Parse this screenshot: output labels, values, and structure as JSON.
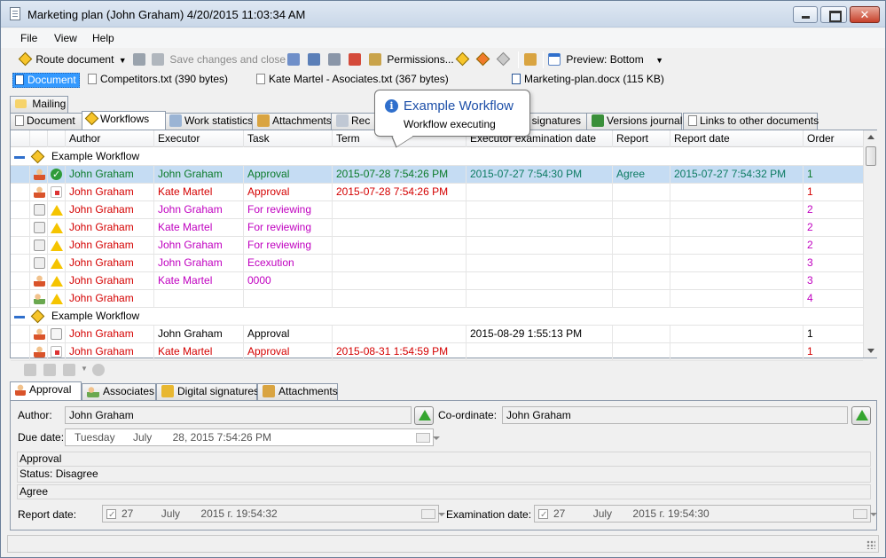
{
  "window": {
    "title": "Marketing plan (John Graham) 4/20/2015 11:03:34 AM"
  },
  "menu": [
    "File",
    "View",
    "Help"
  ],
  "toolbar": {
    "route": "Route document",
    "save_close": "Save changes and close",
    "permissions": "Permissions...",
    "preview": "Preview: Bottom"
  },
  "docs": [
    {
      "label": "Document"
    },
    {
      "label": "Competitors.txt (390 bytes)"
    },
    {
      "label": "Kate Martel - Asociates.txt (367 bytes)"
    },
    {
      "label": "Marketing-plan.docx (115 KB)"
    }
  ],
  "tabs_top": {
    "mailing": "Mailing"
  },
  "tabs": [
    "Document",
    "Workflows",
    "Work statistics",
    "Attachments",
    "Rec",
    "al signatures",
    "Versions journal",
    "Links to other documents"
  ],
  "tooltip": {
    "title": "Example Workflow",
    "subtitle": "Workflow executing",
    "icon": "i"
  },
  "grid": {
    "columns": [
      "Author",
      "Executor",
      "Task",
      "Term",
      "Executor examination date",
      "Report",
      "Report date",
      "Order"
    ],
    "groups": [
      {
        "name": "Example Workflow",
        "rows": [
          {
            "i1": "person",
            "i2": "check",
            "author": "John Graham",
            "executor": "John Graham",
            "task": "Approval",
            "term": "2015-07-28 7:54:26 PM",
            "exam": "2015-07-27 7:54:30 PM",
            "report": "Agree",
            "report_date": "2015-07-27 7:54:32 PM",
            "order": "1",
            "color": "green",
            "selected": true
          },
          {
            "i1": "person",
            "i2": "stop",
            "author": "John Graham",
            "executor": "Kate Martel",
            "task": "Approval",
            "term": "2015-07-28 7:54:26 PM",
            "exam": "",
            "report": "",
            "report_date": "",
            "order": "1",
            "color": "red"
          },
          {
            "i1": "paper",
            "i2": "warn",
            "author": "John Graham",
            "executor": "John Graham",
            "task": "For reviewing",
            "term": "",
            "exam": "",
            "report": "",
            "report_date": "",
            "order": "2",
            "color": "mag"
          },
          {
            "i1": "paper",
            "i2": "warn",
            "author": "John Graham",
            "executor": "Kate Martel",
            "task": "For reviewing",
            "term": "",
            "exam": "",
            "report": "",
            "report_date": "",
            "order": "2",
            "color": "mag"
          },
          {
            "i1": "paper",
            "i2": "warn",
            "author": "John Graham",
            "executor": "John Graham",
            "task": "For reviewing",
            "term": "",
            "exam": "",
            "report": "",
            "report_date": "",
            "order": "2",
            "color": "mag"
          },
          {
            "i1": "paper",
            "i2": "warn",
            "author": "John Graham",
            "executor": "John Graham",
            "task": "Ecexution",
            "term": "",
            "exam": "",
            "report": "",
            "report_date": "",
            "order": "3",
            "color": "mag"
          },
          {
            "i1": "person",
            "i2": "warn",
            "author": "John Graham",
            "executor": "Kate Martel",
            "task": "0000",
            "term": "",
            "exam": "",
            "report": "",
            "report_date": "",
            "order": "3",
            "color": "mag"
          },
          {
            "i1": "group",
            "i2": "warn",
            "author": "John Graham",
            "executor": "",
            "task": "",
            "term": "",
            "exam": "",
            "report": "",
            "report_date": "",
            "order": "4",
            "color": "mag"
          }
        ]
      },
      {
        "name": "Example Workflow",
        "rows": [
          {
            "i1": "person",
            "i2": "env",
            "author": "John Graham",
            "executor": "John Graham",
            "task": "Approval",
            "term": "",
            "exam": "2015-08-29 1:55:13 PM",
            "report": "",
            "report_date": "",
            "order": "1",
            "color": "black"
          },
          {
            "i1": "person",
            "i2": "stop",
            "author": "John Graham",
            "executor": "Kate Martel",
            "task": "Approval",
            "term": "2015-08-31 1:54:59 PM",
            "exam": "",
            "report": "",
            "report_date": "",
            "order": "1",
            "color": "red"
          }
        ]
      }
    ]
  },
  "detail_tabs": [
    "Approval",
    "Associates",
    "Digital signatures",
    "Attachments"
  ],
  "detail": {
    "author_label": "Author:",
    "author": "John Graham",
    "coordinate_label": "Co-ordinate:",
    "coordinate": "John Graham",
    "due_label": "Due date:",
    "due_day": "Tuesday",
    "due_month": "July",
    "due_rest": "28, 2015  7:54:26 PM",
    "type": "Approval",
    "status": "Status: Disagree",
    "comment": "Agree",
    "report_label": "Report date:",
    "report_day": "27",
    "report_month": "July",
    "report_rest": "2015 г. 19:54:32",
    "exam_label": "Examination date:",
    "exam_day": "27",
    "exam_month": "July",
    "exam_rest": "2015 г. 19:54:30"
  },
  "colors": {
    "selected_row": "#c5dcf3",
    "green": "#0a7a29",
    "red": "#d40000",
    "magenta": "#c000c0",
    "accent": "#3399ff"
  }
}
